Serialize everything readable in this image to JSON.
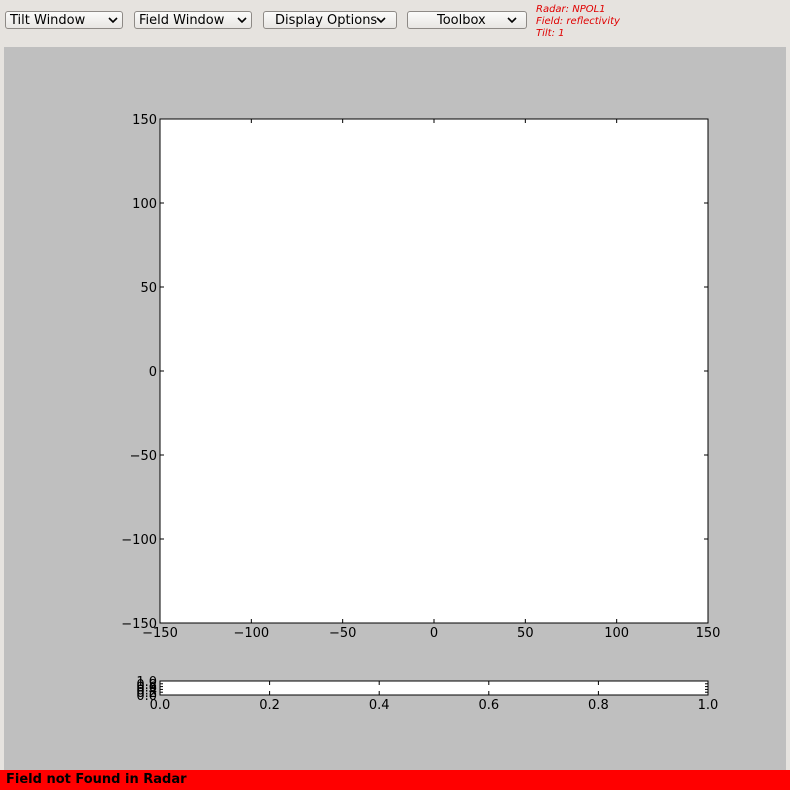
{
  "toolbar": {
    "tilt_window": "Tilt Window",
    "field_window": "Field Window",
    "display_options": "Display Options",
    "toolbox": "Toolbox"
  },
  "info": {
    "radar": "Radar: NPOL1",
    "field": "Field: reflectivity",
    "tilt": "Tilt: 1"
  },
  "status": {
    "message": "Field not Found in Radar",
    "color": "#ff0000"
  },
  "chart_data": [
    {
      "type": "scatter",
      "x": [],
      "y": [],
      "xlim": [
        -150,
        150
      ],
      "ylim": [
        -150,
        150
      ],
      "xticks": [
        -150,
        -100,
        -50,
        0,
        50,
        100,
        150
      ],
      "yticks": [
        -150,
        -100,
        -50,
        0,
        50,
        100,
        150
      ],
      "xtick_labels": [
        "−150",
        "−100",
        "−50",
        "0",
        "50",
        "100",
        "150"
      ],
      "ytick_labels": [
        "−150",
        "−100",
        "−50",
        "0",
        "50",
        "100",
        "150"
      ],
      "grid": false
    },
    {
      "type": "heatmap",
      "x": [],
      "y": [],
      "xlim": [
        0,
        1
      ],
      "ylim": [
        0,
        1
      ],
      "xticks": [
        0,
        0.2,
        0.4,
        0.6,
        0.8,
        1
      ],
      "xtick_labels": [
        "0.0",
        "0.2",
        "0.4",
        "0.6",
        "0.8",
        "1.0"
      ],
      "yticks": [
        0,
        0.2,
        0.4,
        0.6,
        0.8,
        1
      ],
      "ytick_labels": [
        "0.0",
        "0.2",
        "0.4",
        "0.6",
        "0.8",
        "1.0"
      ],
      "grid": false
    }
  ]
}
